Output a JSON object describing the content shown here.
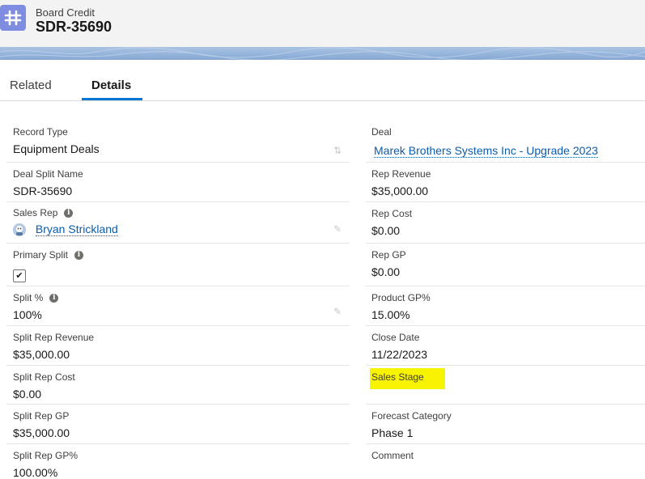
{
  "header": {
    "object_type": "Board Credit",
    "record_title": "SDR-35690"
  },
  "tabs": [
    {
      "label": "Related"
    },
    {
      "label": "Details"
    }
  ],
  "left_fields": {
    "record_type": {
      "label": "Record Type",
      "value": "Equipment Deals"
    },
    "deal_split_name": {
      "label": "Deal Split Name",
      "value": "SDR-35690"
    },
    "sales_rep": {
      "label": "Sales Rep",
      "value": "Bryan Strickland"
    },
    "primary_split": {
      "label": "Primary Split",
      "checked": true
    },
    "split_pct": {
      "label": "Split %",
      "value": "100%"
    },
    "split_rep_revenue": {
      "label": "Split Rep Revenue",
      "value": "$35,000.00"
    },
    "split_rep_cost": {
      "label": "Split Rep Cost",
      "value": "$0.00"
    },
    "split_rep_gp": {
      "label": "Split Rep GP",
      "value": "$35,000.00"
    },
    "split_rep_gp_pct": {
      "label": "Split Rep GP%",
      "value": "100.00%"
    }
  },
  "right_fields": {
    "deal": {
      "label": "Deal",
      "value": "Marek Brothers Systems Inc - Upgrade 2023"
    },
    "rep_revenue": {
      "label": "Rep Revenue",
      "value": "$35,000.00"
    },
    "rep_cost": {
      "label": "Rep Cost",
      "value": "$0.00"
    },
    "rep_gp": {
      "label": "Rep GP",
      "value": "$0.00"
    },
    "product_gp_pct": {
      "label": "Product GP%",
      "value": "15.00%"
    },
    "close_date": {
      "label": "Close Date",
      "value": "11/22/2023"
    },
    "sales_stage": {
      "label": "Sales Stage",
      "value": ""
    },
    "forecast_category": {
      "label": "Forecast Category",
      "value": "Phase 1"
    },
    "comment": {
      "label": "Comment",
      "value": ""
    }
  },
  "icons": {
    "object": "hash-icon",
    "info": "info-icon",
    "edit": "pencil-icon",
    "change_record_type": "swap-icon",
    "user": "user-avatar-icon",
    "check": "checkmark-icon"
  },
  "colors": {
    "link": "#0b5cab",
    "active_tab": "#0176d3",
    "highlight": "#f8f300",
    "object_icon": "#7f8de1"
  }
}
